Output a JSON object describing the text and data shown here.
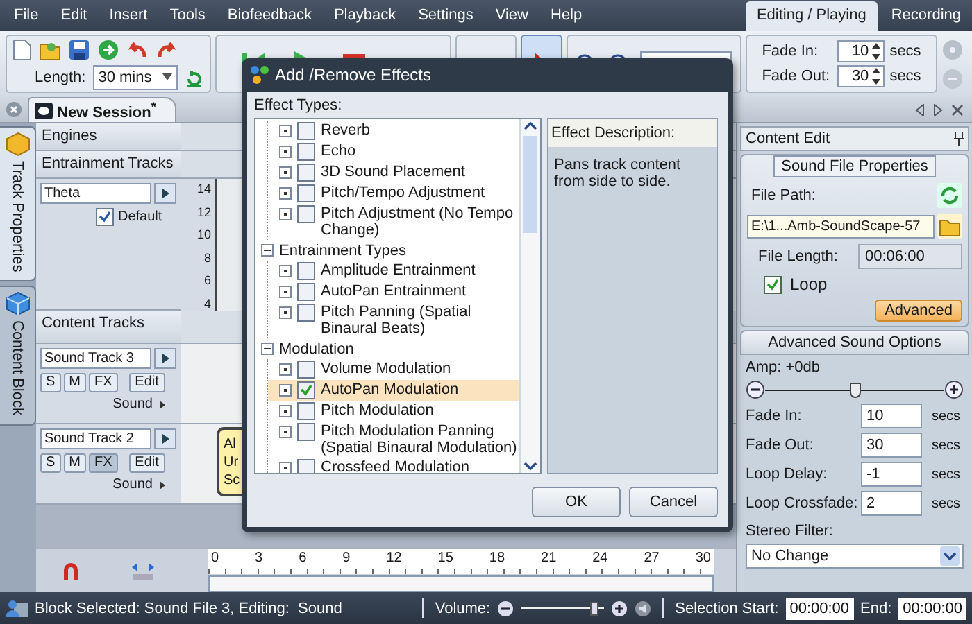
{
  "menu": [
    {
      "label": "File"
    },
    {
      "label": "Edit"
    },
    {
      "label": "Insert"
    },
    {
      "label": "Tools"
    },
    {
      "label": "Biofeedback"
    },
    {
      "label": "Playback"
    },
    {
      "label": "Settings"
    },
    {
      "label": "View"
    },
    {
      "label": "Help"
    }
  ],
  "mode_tabs": [
    {
      "label": "Editing / Playing",
      "selected": true
    },
    {
      "label": "Recording",
      "selected": false
    }
  ],
  "toolbar": {
    "length_label": "Length:",
    "length_value": "30 mins",
    "fade_in_label": "Fade In:",
    "fade_in_value": "10",
    "fade_in_unit": "secs",
    "fade_out_label": "Fade Out:",
    "fade_out_value": "30",
    "fade_out_unit": "secs"
  },
  "session_tab": {
    "title": "New Session$^{*}$"
  },
  "side_tabs": [
    {
      "label": "Track Properties",
      "selected": true
    },
    {
      "label": "Content Block",
      "selected": false
    }
  ],
  "engines": {
    "title": "Engines"
  },
  "entrainment": {
    "title": "Entrainment Tracks",
    "track": "Theta",
    "default_label": "Default",
    "default_checked": true,
    "axis_labels": [
      "14",
      "12",
      "10",
      "8",
      "6",
      "4"
    ]
  },
  "content_tracks": {
    "title": "Content Tracks",
    "tracks": [
      {
        "name": "Sound Track 3",
        "buttons": [
          {
            "label": "S",
            "pressed": false
          },
          {
            "label": "M",
            "pressed": false
          },
          {
            "label": "FX",
            "pressed": false
          },
          {
            "label": "Edit",
            "pressed": false
          }
        ],
        "type": "Sound"
      },
      {
        "name": "Sound Track 2",
        "buttons": [
          {
            "label": "S",
            "pressed": false
          },
          {
            "label": "M",
            "pressed": false
          },
          {
            "label": "FX",
            "pressed": true
          },
          {
            "label": "Edit",
            "pressed": false
          }
        ],
        "type": "Sound"
      }
    ]
  },
  "content_block": {
    "lines": [
      "Al",
      "Ur",
      "Sc"
    ]
  },
  "ruler": {
    "labels": [
      "0",
      "3",
      "6",
      "9",
      "12",
      "15",
      "18",
      "21",
      "24",
      "27",
      "30"
    ]
  },
  "dialog": {
    "title": "Add /Remove Effects",
    "types_label": "Effect Types:",
    "tree": [
      {
        "kind": "continued",
        "children": [
          {
            "label": "Reverb",
            "checked": false,
            "selected": false
          },
          {
            "label": "Echo",
            "checked": false,
            "selected": false
          },
          {
            "label": "3D Sound Placement",
            "checked": false,
            "selected": false
          },
          {
            "label": "Pitch/Tempo Adjustment",
            "checked": false,
            "selected": false
          },
          {
            "label": "Pitch Adjustment (No Tempo Change)",
            "checked": false,
            "selected": false
          }
        ]
      },
      {
        "kind": "group",
        "label": "Entrainment Types",
        "expanded": true,
        "children": [
          {
            "label": "Amplitude Entrainment",
            "checked": false,
            "selected": false
          },
          {
            "label": "AutoPan Entrainment",
            "checked": false,
            "selected": false
          },
          {
            "label": "Pitch Panning (Spatial Binaural Beats)",
            "checked": false,
            "selected": false
          }
        ]
      },
      {
        "kind": "group",
        "label": "Modulation",
        "expanded": true,
        "children": [
          {
            "label": "Volume Modulation",
            "checked": false,
            "selected": false
          },
          {
            "label": "AutoPan Modulation",
            "checked": true,
            "selected": true
          },
          {
            "label": "Pitch Modulation",
            "checked": false,
            "selected": false
          },
          {
            "label": "Pitch Modulation Panning (Spatial Binaural Modulation)",
            "checked": false,
            "selected": false
          },
          {
            "label": "Crossfeed Modulation",
            "checked": false,
            "selected": false
          }
        ]
      }
    ],
    "description_title": "Effect Description:",
    "description_text": "Pans track content from side to side.",
    "buttons": [
      "OK",
      "Cancel"
    ]
  },
  "content_edit": {
    "title": "Content Edit",
    "section_title": "Sound File Properties",
    "file_path_label": "File Path:",
    "file_path_value": "E:\\1...Amb-SoundScape-57",
    "file_length_label": "File Length:",
    "file_length_value": "00:06:00",
    "loop_label": "Loop",
    "loop_checked": true,
    "advanced_button": "Advanced",
    "advanced_title": "Advanced Sound Options",
    "amp_label": "Amp: +0db",
    "amp_slider": {
      "level": 0.5
    },
    "fields": [
      {
        "label": "Fade In:",
        "value": "10",
        "unit": "secs"
      },
      {
        "label": "Fade Out:",
        "value": "30",
        "unit": "secs"
      },
      {
        "label": "Loop Delay:",
        "value": "-1",
        "unit": "secs"
      },
      {
        "label": "Loop Crossfade:",
        "value": "2",
        "unit": "secs"
      }
    ],
    "stereo_label": "Stereo Filter:",
    "stereo_value": "No Change"
  },
  "status_bar": {
    "text": "Block Selected: Sound File 3, Editing:  Sound",
    "volume_label": "Volume:",
    "volume_slider": {
      "level": 0.88
    },
    "selection_start_label": "Selection Start:",
    "selection_start_value": "00:00:00",
    "end_label": "End:",
    "end_value": "00:00:00"
  }
}
